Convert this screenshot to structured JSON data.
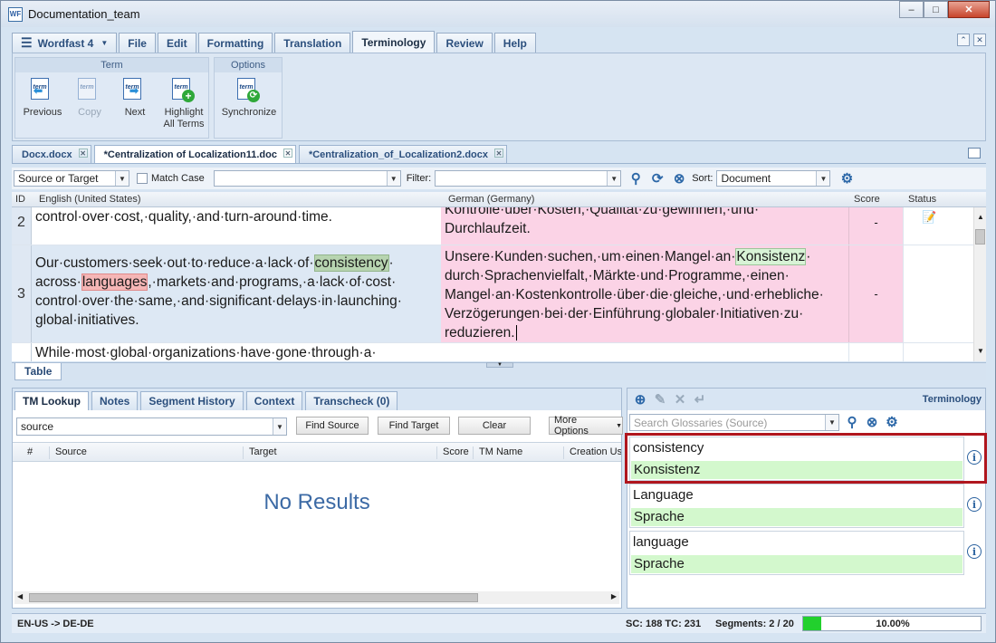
{
  "window": {
    "title": "Documentation_team"
  },
  "menu": {
    "tabs": [
      "Wordfast 4",
      "File",
      "Edit",
      "Formatting",
      "Translation",
      "Terminology",
      "Review",
      "Help"
    ],
    "active": "Terminology"
  },
  "ribbon": {
    "term_group": "Term",
    "options_group": "Options",
    "buttons": {
      "previous": "Previous",
      "copy": "Copy",
      "next": "Next",
      "highlight_line1": "Highlight",
      "highlight_line2": "All Terms",
      "synchronize": "Synchronize"
    },
    "icon_text": "term"
  },
  "doc_tabs": [
    "Docx.docx",
    "*Centralization of Localization11.doc",
    "*Centralization_of_Localization2.docx"
  ],
  "filter": {
    "scope": "Source or Target",
    "match_case": "Match Case",
    "filter_label": "Filter:",
    "sort_label": "Sort:",
    "sort_value": "Document"
  },
  "grid": {
    "headers": {
      "id": "ID",
      "source": "English (United States)",
      "target": "German (Germany)",
      "score": "Score",
      "status": "Status"
    },
    "rows": [
      {
        "id": "2",
        "source": "control·over·cost,·quality,·and·turn-around·time.",
        "target_line1": "Kontrolle·über·Kosten,·Qualität·zu·gewinnen,·und·",
        "target_line2": "Durchlaufzeit.",
        "score": "-"
      },
      {
        "id": "3",
        "src_a": "Our·customers·seek·out·to·reduce·a·lack·of·",
        "src_hl1": "consistency",
        "src_b": "·",
        "src_c": "across·",
        "src_hl2": "languages",
        "src_d": ",·markets·and·programs,·a·lack·of·cost·",
        "src_e": "control·over·the·same,·and·significant·delays·in·launching·",
        "src_f": "global·initiatives.",
        "tgt_a": "Unsere·Kunden·suchen,·um·einen·Mangel·an·",
        "tgt_hl": "Konsistenz",
        "tgt_b": "·",
        "tgt_c": "durch·Sprachenvielfalt,·Märkte·und·Programme,·einen·",
        "tgt_d": "Mangel·an·Kostenkontrolle·über·die·gleiche,·und·erhebliche·",
        "tgt_e": "Verzögerungen·bei·der·Einführung·globaler·Initiativen·zu·",
        "tgt_f": "reduzieren.",
        "score": "-"
      },
      {
        "id": "",
        "source": "While·most·global·organizations·have·gone·through·a·"
      }
    ],
    "table_tab": "Table"
  },
  "lower_left": {
    "tabs": [
      "TM Lookup",
      "Notes",
      "Segment History",
      "Context",
      "Transcheck (0)"
    ],
    "search_scope": "source",
    "buttons": {
      "find_source": "Find Source",
      "find_target": "Find Target",
      "clear": "Clear",
      "more": "More Options"
    },
    "columns": [
      "#",
      "Source",
      "Target",
      "Score",
      "TM Name",
      "Creation Use"
    ],
    "empty": "No Results"
  },
  "terminology": {
    "title": "Terminology",
    "search_placeholder": "Search Glossaries (Source)",
    "entries": [
      {
        "source": "consistency",
        "target": "Konsistenz"
      },
      {
        "source": "Language",
        "target": "Sprache"
      },
      {
        "source": "language",
        "target": "Sprache"
      }
    ]
  },
  "status": {
    "lang_pair": "EN-US -> DE-DE",
    "counts": "SC: 188 TC: 231",
    "segments": "Segments: 2 / 20",
    "progress_label": "10.00%",
    "progress_value": 0.1
  },
  "colors": {
    "accent": "#2b4f7d",
    "target_pink": "#fbd3e6",
    "term_green": "#d3f8cd",
    "highlight_box": "#b0161e",
    "progress": "#22d02d"
  }
}
